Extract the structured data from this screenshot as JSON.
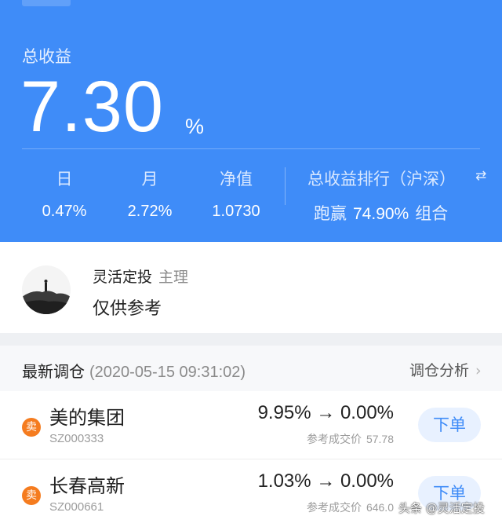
{
  "header": {
    "total_return_label": "总收益",
    "total_return_value": "7.30",
    "total_return_unit": "%",
    "stats": [
      {
        "label": "日",
        "value": "0.47%"
      },
      {
        "label": "月",
        "value": "2.72%"
      },
      {
        "label": "净值",
        "value": "1.0730"
      }
    ],
    "ranking": {
      "title": "总收益排行（沪深）",
      "switch_icon": "swap-arrows-icon",
      "prefix": "跑赢",
      "value": "74.90%",
      "suffix": "组合"
    },
    "accent_color": "#3f8cf8"
  },
  "owner": {
    "name": "灵活定投",
    "role": "主理",
    "description": "仅供参考",
    "avatar_icon": "mountain-silhouette-avatar"
  },
  "rebalance": {
    "title": "最新调仓",
    "time": "(2020-05-15 09:31:02)",
    "action_label": "调仓分析",
    "action_icon": "chevron-right-icon",
    "items": [
      {
        "badge": "卖",
        "name": "美的集团",
        "code": "SZ000333",
        "weight_change": "9.95% → 0.00%",
        "price_label": "参考成交价",
        "price": "57.78",
        "button_label": "下单"
      },
      {
        "badge": "卖",
        "name": "长春高新",
        "code": "SZ000661",
        "weight_change": "1.03% → 0.00%",
        "price_label": "参考成交价",
        "price": "646.0",
        "button_label": "下单"
      }
    ],
    "badge_color": "#f57c1f"
  },
  "watermark": "头条 @灵活定投"
}
